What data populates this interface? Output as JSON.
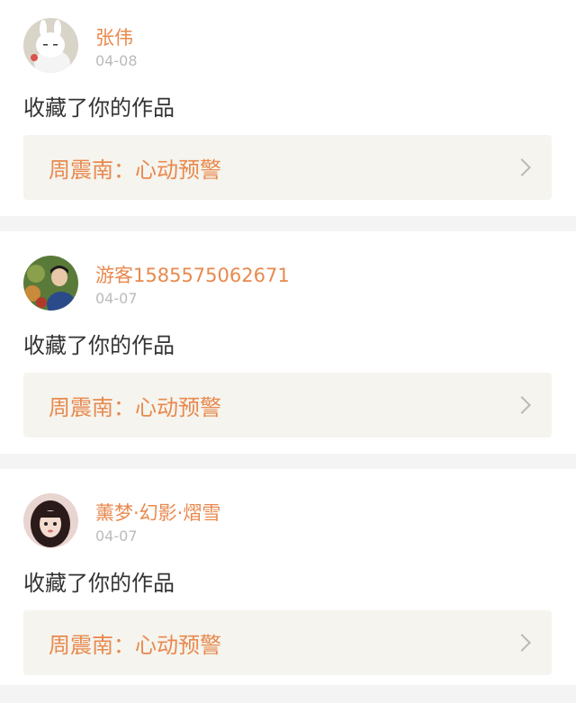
{
  "notifications": [
    {
      "user": "张伟",
      "date": "04-08",
      "action": "收藏了你的作品",
      "work_title": "周震南：心动预警",
      "avatar_icon": "white-rabbit-avatar-icon"
    },
    {
      "user": "游客1585575062671",
      "date": "04-07",
      "action": "收藏了你的作品",
      "work_title": "周震南：心动预警",
      "avatar_icon": "boy-photo-avatar-icon"
    },
    {
      "user": "薰梦·幻影·熠雪",
      "date": "04-07",
      "action": "收藏了你的作品",
      "work_title": "周震南：心动预警",
      "avatar_icon": "girl-photo-avatar-icon"
    }
  ],
  "colors": {
    "accent": "#e8894e",
    "text": "#333333",
    "muted": "#bbbbbb",
    "link_bg": "#f5f4ee",
    "page_bg": "#f4f4f4"
  }
}
